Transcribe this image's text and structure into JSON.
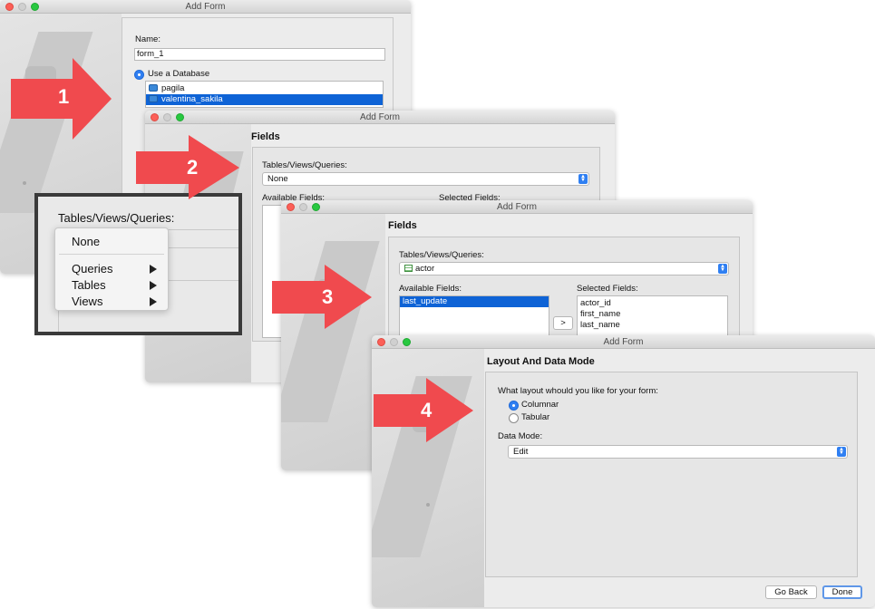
{
  "window_title": "Add Form",
  "step1": {
    "name_label": "Name:",
    "name_value": "form_1",
    "db_option_label": "Use a Database",
    "databases": [
      "pagila",
      "valentina_sakila"
    ]
  },
  "step2": {
    "heading": "Fields",
    "tvq_label": "Tables/Views/Queries:",
    "tvq_value": "None",
    "available_label": "Available Fields:",
    "selected_label": "Selected Fields:"
  },
  "zoom_menu": {
    "title": "Tables/Views/Queries:",
    "items": [
      "None",
      "Queries",
      "Tables",
      "Views"
    ]
  },
  "step3": {
    "heading": "Fields",
    "tvq_label": "Tables/Views/Queries:",
    "tvq_value": "actor",
    "available_label": "Available Fields:",
    "available_fields": [
      "last_update"
    ],
    "selected_label": "Selected Fields:",
    "selected_fields": [
      "actor_id",
      "first_name",
      "last_name"
    ],
    "move_button": ">"
  },
  "step4": {
    "heading": "Layout And Data Mode",
    "question": "What layout whould you like for your form:",
    "layouts": [
      "Columnar",
      "Tabular"
    ],
    "data_mode_label": "Data Mode:",
    "data_mode_value": "Edit",
    "go_back": "Go Back",
    "done": "Done"
  },
  "step_numbers": [
    "1",
    "2",
    "3",
    "4"
  ],
  "colors": {
    "arrow": "#f04a4e",
    "selection": "#0e63d6",
    "accent": "#2f7ff2"
  }
}
